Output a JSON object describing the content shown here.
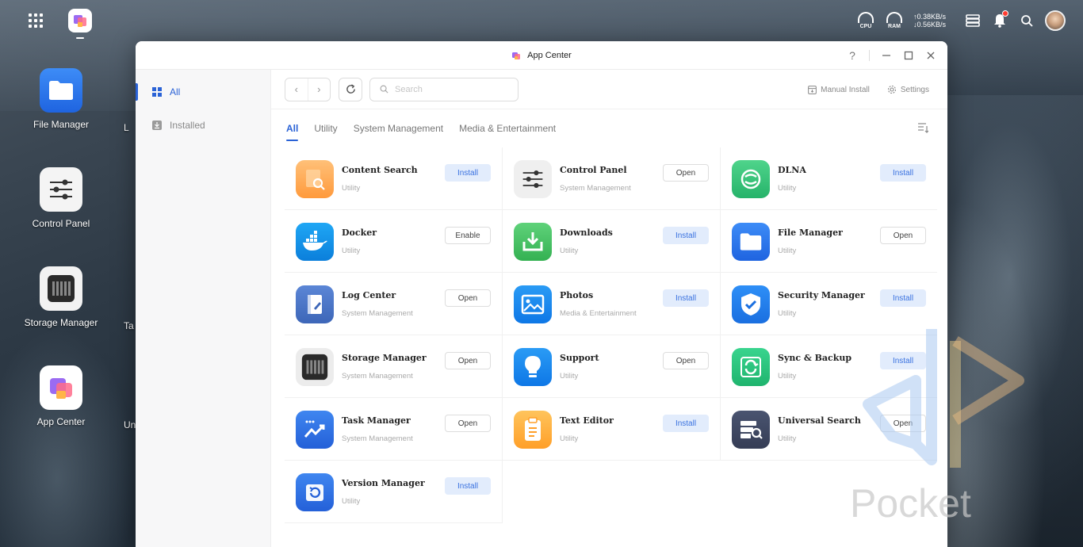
{
  "topbar": {
    "cpu_label": "CPU",
    "ram_label": "RAM",
    "upload_speed": "↑0.38KB/s",
    "download_speed": "↓0.56KB/s"
  },
  "desktop": {
    "items": [
      {
        "label": "File Manager"
      },
      {
        "label": "Control Panel"
      },
      {
        "label": "Storage Manager"
      },
      {
        "label": "App Center"
      }
    ],
    "partial_labels": [
      "L",
      "",
      "Ta",
      "Uni"
    ]
  },
  "window": {
    "title": "App Center",
    "help": "?"
  },
  "sidebar": {
    "items": [
      {
        "label": "All",
        "active": true
      },
      {
        "label": "Installed",
        "active": false
      }
    ]
  },
  "toolbar": {
    "back": "‹",
    "forward": "›",
    "search_placeholder": "Search",
    "manual_install": "Manual Install",
    "settings": "Settings"
  },
  "tabs": [
    {
      "label": "All",
      "active": true
    },
    {
      "label": "Utility",
      "active": false
    },
    {
      "label": "System Management",
      "active": false
    },
    {
      "label": "Media & Entertainment",
      "active": false
    }
  ],
  "apps": [
    {
      "name": "Content Search",
      "category": "Utility",
      "button": "Install",
      "icon": "content-search-icon"
    },
    {
      "name": "Control Panel",
      "category": "System Management",
      "button": "Open",
      "icon": "control-panel-icon"
    },
    {
      "name": "DLNA",
      "category": "Utility",
      "button": "Install",
      "icon": "dlna-icon"
    },
    {
      "name": "Docker",
      "category": "Utility",
      "button": "Enable",
      "icon": "docker-icon"
    },
    {
      "name": "Downloads",
      "category": "Utility",
      "button": "Install",
      "icon": "downloads-icon"
    },
    {
      "name": "File Manager",
      "category": "Utility",
      "button": "Open",
      "icon": "file-manager-icon"
    },
    {
      "name": "Log Center",
      "category": "System Management",
      "button": "Open",
      "icon": "log-center-icon"
    },
    {
      "name": "Photos",
      "category": "Media & Entertainment",
      "button": "Install",
      "icon": "photos-icon"
    },
    {
      "name": "Security Manager",
      "category": "Utility",
      "button": "Install",
      "icon": "security-manager-icon"
    },
    {
      "name": "Storage Manager",
      "category": "System Management",
      "button": "Open",
      "icon": "storage-manager-icon"
    },
    {
      "name": "Support",
      "category": "Utility",
      "button": "Open",
      "icon": "support-icon"
    },
    {
      "name": "Sync & Backup",
      "category": "Utility",
      "button": "Install",
      "icon": "sync-backup-icon"
    },
    {
      "name": "Task Manager",
      "category": "System Management",
      "button": "Open",
      "icon": "task-manager-icon"
    },
    {
      "name": "Text Editor",
      "category": "Utility",
      "button": "Install",
      "icon": "text-editor-icon"
    },
    {
      "name": "Universal Search",
      "category": "Utility",
      "button": "Open",
      "icon": "universal-search-icon"
    },
    {
      "name": "Version Manager",
      "category": "Utility",
      "button": "Install",
      "icon": "version-manager-icon"
    }
  ],
  "watermark": "Pocket"
}
